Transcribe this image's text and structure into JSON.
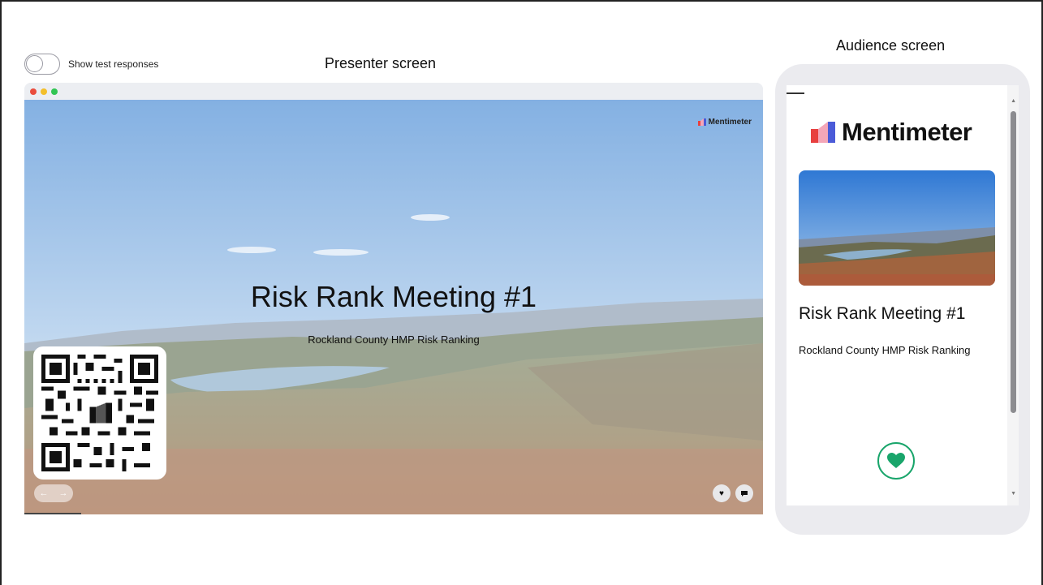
{
  "controls": {
    "test_responses_label": "Show test responses",
    "test_responses_on": false
  },
  "headings": {
    "presenter": "Presenter screen",
    "audience": "Audience screen"
  },
  "brand": {
    "name": "Mentimeter",
    "colors": {
      "red": "#e8403f",
      "blue": "#4b5bd8",
      "pink": "#f4a6b8",
      "accent_green": "#19a56b"
    }
  },
  "slide": {
    "title": "Risk Rank Meeting #1",
    "subtitle": "Rockland County HMP Risk Ranking",
    "nav_icons": [
      "arrow-left-icon",
      "arrow-right-icon"
    ],
    "reaction_icons": [
      "heart-icon",
      "comment-icon"
    ]
  },
  "audience": {
    "title": "Risk Rank Meeting #1",
    "subtitle": "Rockland County HMP Risk Ranking",
    "reaction_icon": "heart-icon"
  }
}
